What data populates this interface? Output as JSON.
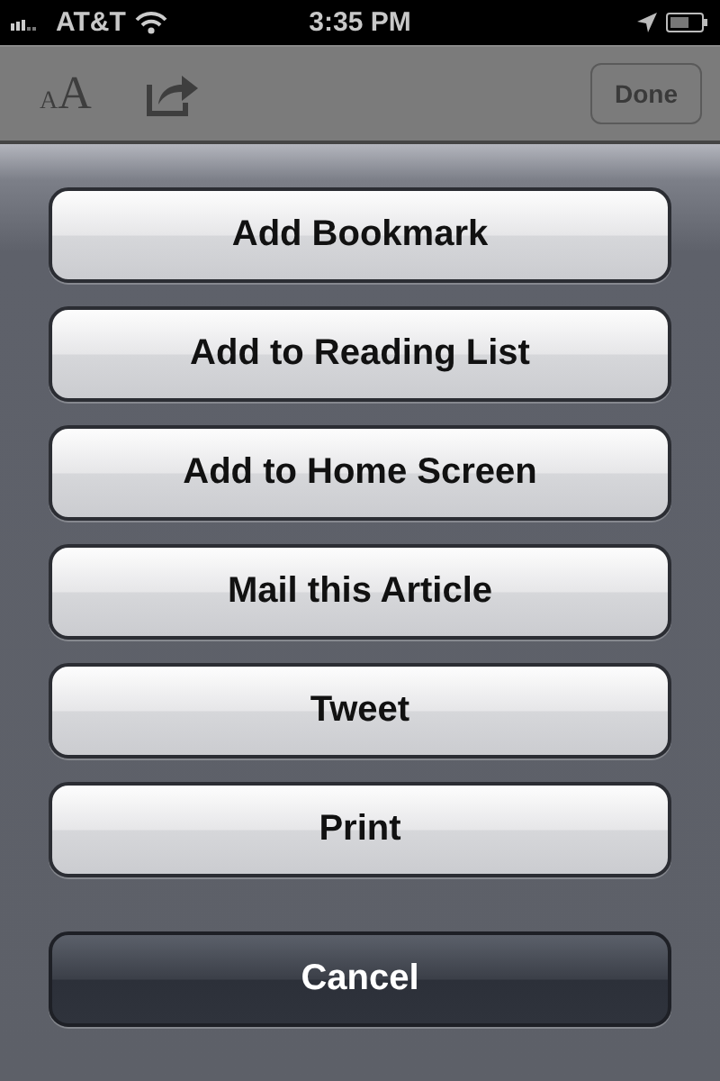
{
  "status_bar": {
    "carrier": "AT&T",
    "time": "3:35 PM"
  },
  "toolbar": {
    "text_size_glyphs": [
      "A",
      "A"
    ],
    "done_button": "Done"
  },
  "action_sheet": {
    "actions": [
      {
        "label": "Add Bookmark",
        "kind": "default"
      },
      {
        "label": "Add to Reading List",
        "kind": "default"
      },
      {
        "label": "Add to Home Screen",
        "kind": "default"
      },
      {
        "label": "Mail this Article",
        "kind": "default"
      },
      {
        "label": "Tweet",
        "kind": "default"
      },
      {
        "label": "Print",
        "kind": "default"
      },
      {
        "label": "Cancel",
        "kind": "cancel"
      }
    ]
  }
}
